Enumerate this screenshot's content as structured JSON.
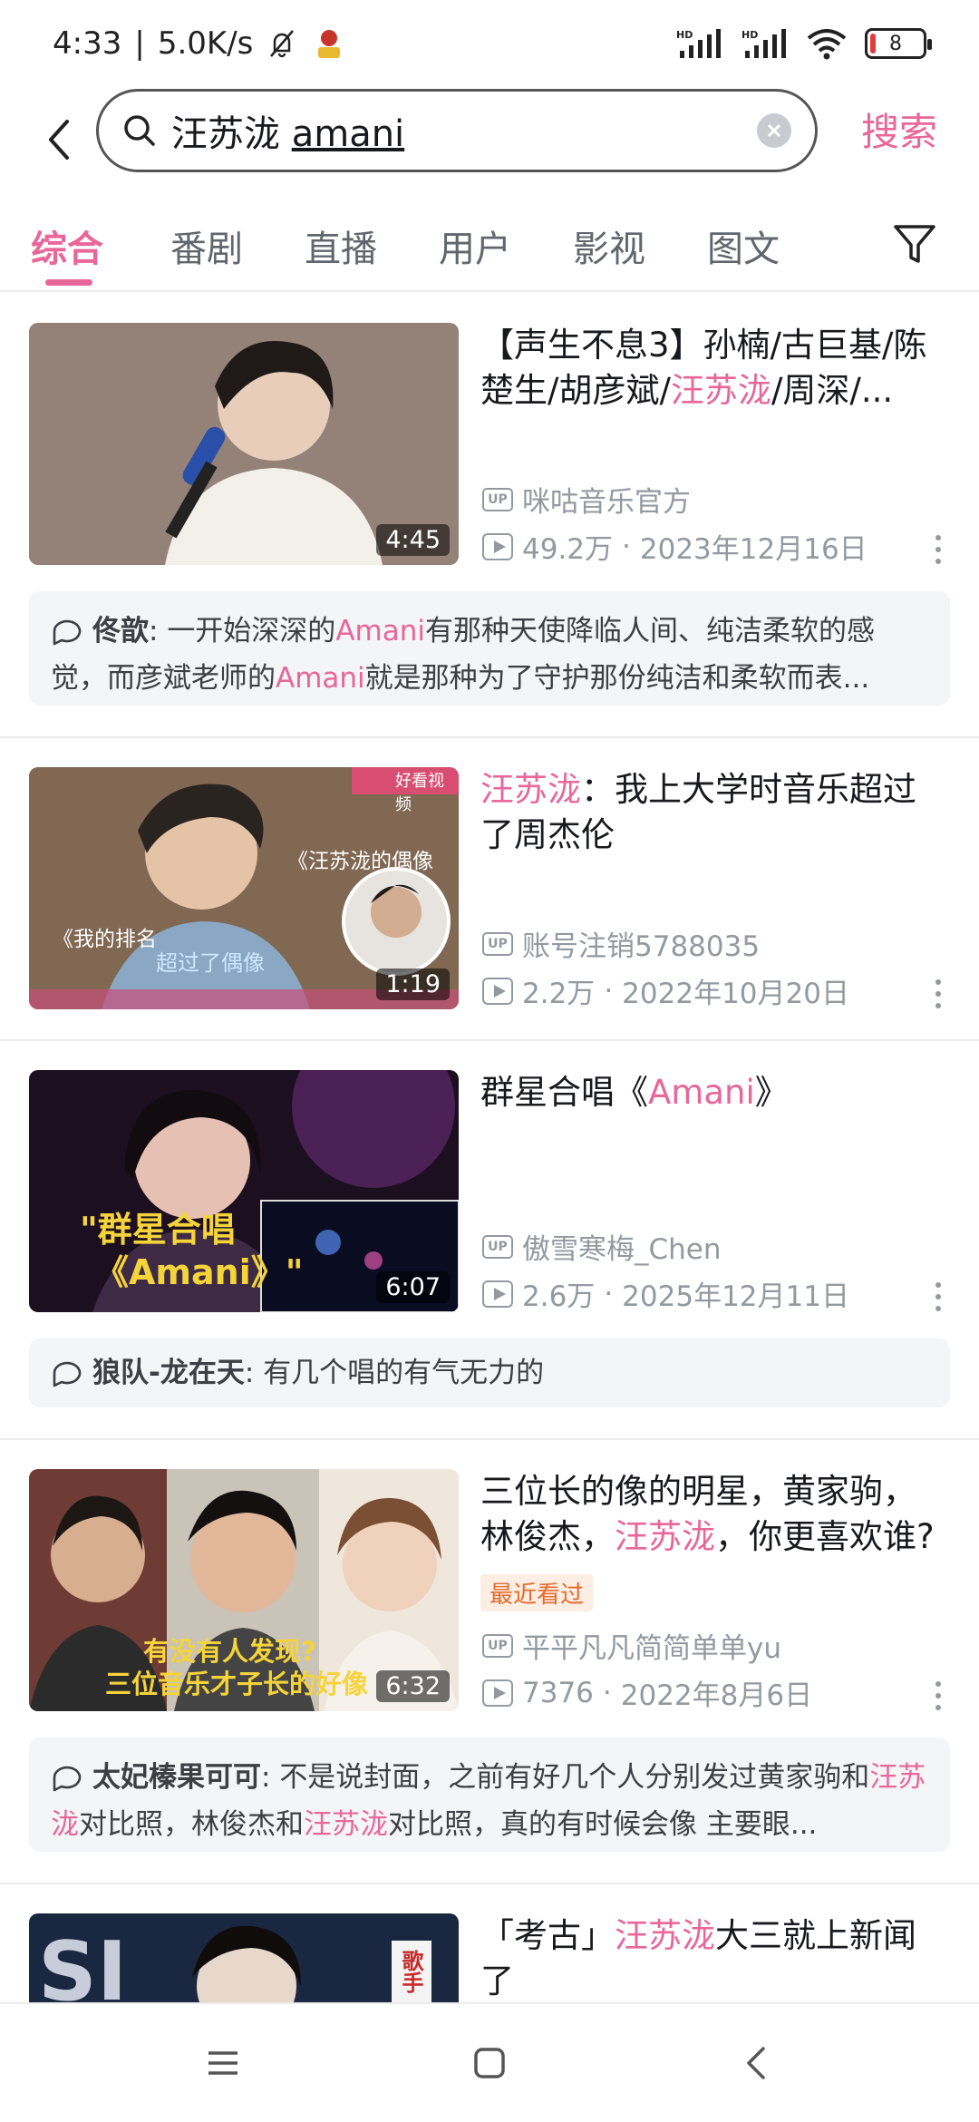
{
  "status": {
    "time": "4:33",
    "speed": "5.0K/s",
    "battery": "8",
    "signal1": "HD",
    "signal2": "HD"
  },
  "search": {
    "query_part1": "汪苏泷",
    "query_part2": "amani",
    "search_button": "搜索"
  },
  "tabs": [
    "综合",
    "番剧",
    "直播",
    "用户",
    "影视",
    "图文"
  ],
  "results": [
    {
      "title_pre": "【声生不息3】孙楠/古巨基/陈楚生/胡彦斌/",
      "title_hl": "汪苏泷",
      "title_post": "/周深/...",
      "uploader": "咪咕音乐官方",
      "views": "49.2万",
      "date": "2023年12月16日",
      "duration": "4:45",
      "comment": {
        "author": "佟歆",
        "sep": ": ",
        "t1": "一开始深深的",
        "h1": "Amani",
        "t2": "有那种天使降临人间、纯洁柔软的感觉，而彦斌老师的",
        "h2": "Amani",
        "t3": "就是那种为了守护那份纯洁和柔软而表..."
      }
    },
    {
      "title_pre": "",
      "title_hl": "汪苏泷",
      "title_post": "：我上大学时音乐超过了周杰伦",
      "uploader": "账号注销5788035",
      "views": "2.2万",
      "date": "2022年10月20日",
      "duration": "1:19",
      "overlay_texts": [
        "《汪苏泷的偶像",
        "《我的排名",
        "超过了偶像",
        "好看视频"
      ]
    },
    {
      "title_pre": "群星合唱《",
      "title_hl": "Amani",
      "title_post": "》",
      "uploader": "傲雪寒梅_Chen",
      "views": "2.6万",
      "date": "2025年12月11日",
      "duration": "6:07",
      "overlay_texts": [
        "\"群星合唱",
        "《Amani》\""
      ],
      "comment": {
        "author": "狼队-龙在天",
        "sep": ": ",
        "t1": "有几个唱的有气无力的"
      }
    },
    {
      "title_pre": "三位长的像的明星，黄家驹，林俊杰，",
      "title_hl": "汪苏泷",
      "title_post": "，你更喜欢谁?",
      "recent": "最近看过",
      "uploader": "平平凡凡简简单单yu",
      "views": "7376",
      "date": "2022年8月6日",
      "duration": "6:32",
      "overlay_texts": [
        "有没有人发现?",
        "三位音乐才子长的好像"
      ],
      "comment": {
        "author": "太妃榛果可可",
        "sep": ": ",
        "t1": "不是说封面，之前有好几个人分别发过黄家驹和",
        "h1": "汪苏泷",
        "t2": "对比照，林俊杰和",
        "h2": "汪苏泷",
        "t3": "对比照，真的有时候会像 主要眼..."
      }
    },
    {
      "title_pre": "「考古」",
      "title_hl": "汪苏泷",
      "title_post": "大三就上新闻了",
      "overlay_texts": [
        "歌手"
      ]
    }
  ],
  "colors": {
    "accent": "#e8669a",
    "meta": "#9499a0",
    "comment_bg": "#f4f5f7"
  }
}
